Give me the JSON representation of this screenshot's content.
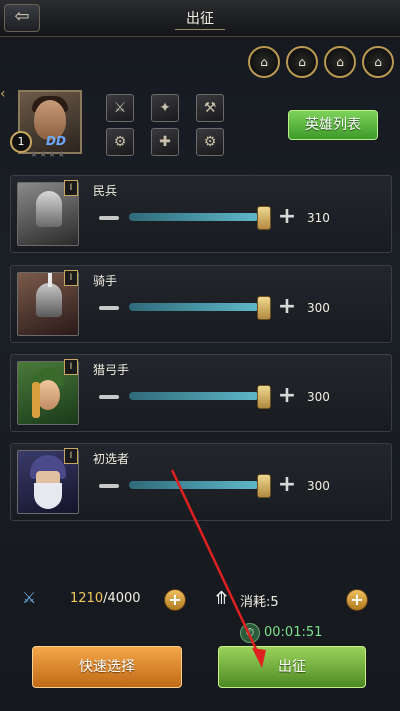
{
  "header": {
    "title": "出征",
    "back_icon": "back-arrow-icon"
  },
  "formation_slots": [
    {
      "icon": "formation-icon-1",
      "glyph": "⌂"
    },
    {
      "icon": "formation-icon-2",
      "glyph": "⌂"
    },
    {
      "icon": "formation-icon-3",
      "glyph": "⌂"
    },
    {
      "icon": "formation-icon-4",
      "glyph": "⌂"
    }
  ],
  "hero": {
    "level": "1",
    "badge": "DD",
    "stars": "★★★★",
    "equipment": [
      "⚔",
      "✦",
      "⚒",
      "⚙",
      "✚",
      "⚙"
    ],
    "hero_list_label": "英雄列表"
  },
  "troops": [
    {
      "name": "民兵",
      "tier": "I",
      "value": "310",
      "fill": 0.95
    },
    {
      "name": "骑手",
      "tier": "I",
      "value": "300",
      "fill": 0.95
    },
    {
      "name": "猎弓手",
      "tier": "I",
      "value": "300",
      "fill": 0.95
    },
    {
      "name": "初选者",
      "tier": "I",
      "value": "300",
      "fill": 0.95
    }
  ],
  "capacity": {
    "current": "1210",
    "max": "/4000"
  },
  "consume": {
    "label": "消耗:5"
  },
  "timer": {
    "value": "00:01:51"
  },
  "buttons": {
    "quick_select": "快速选择",
    "march": "出征"
  },
  "colors": {
    "accent_green": "#4e8a24",
    "accent_orange": "#c06a18",
    "arrow": "#e02020"
  }
}
